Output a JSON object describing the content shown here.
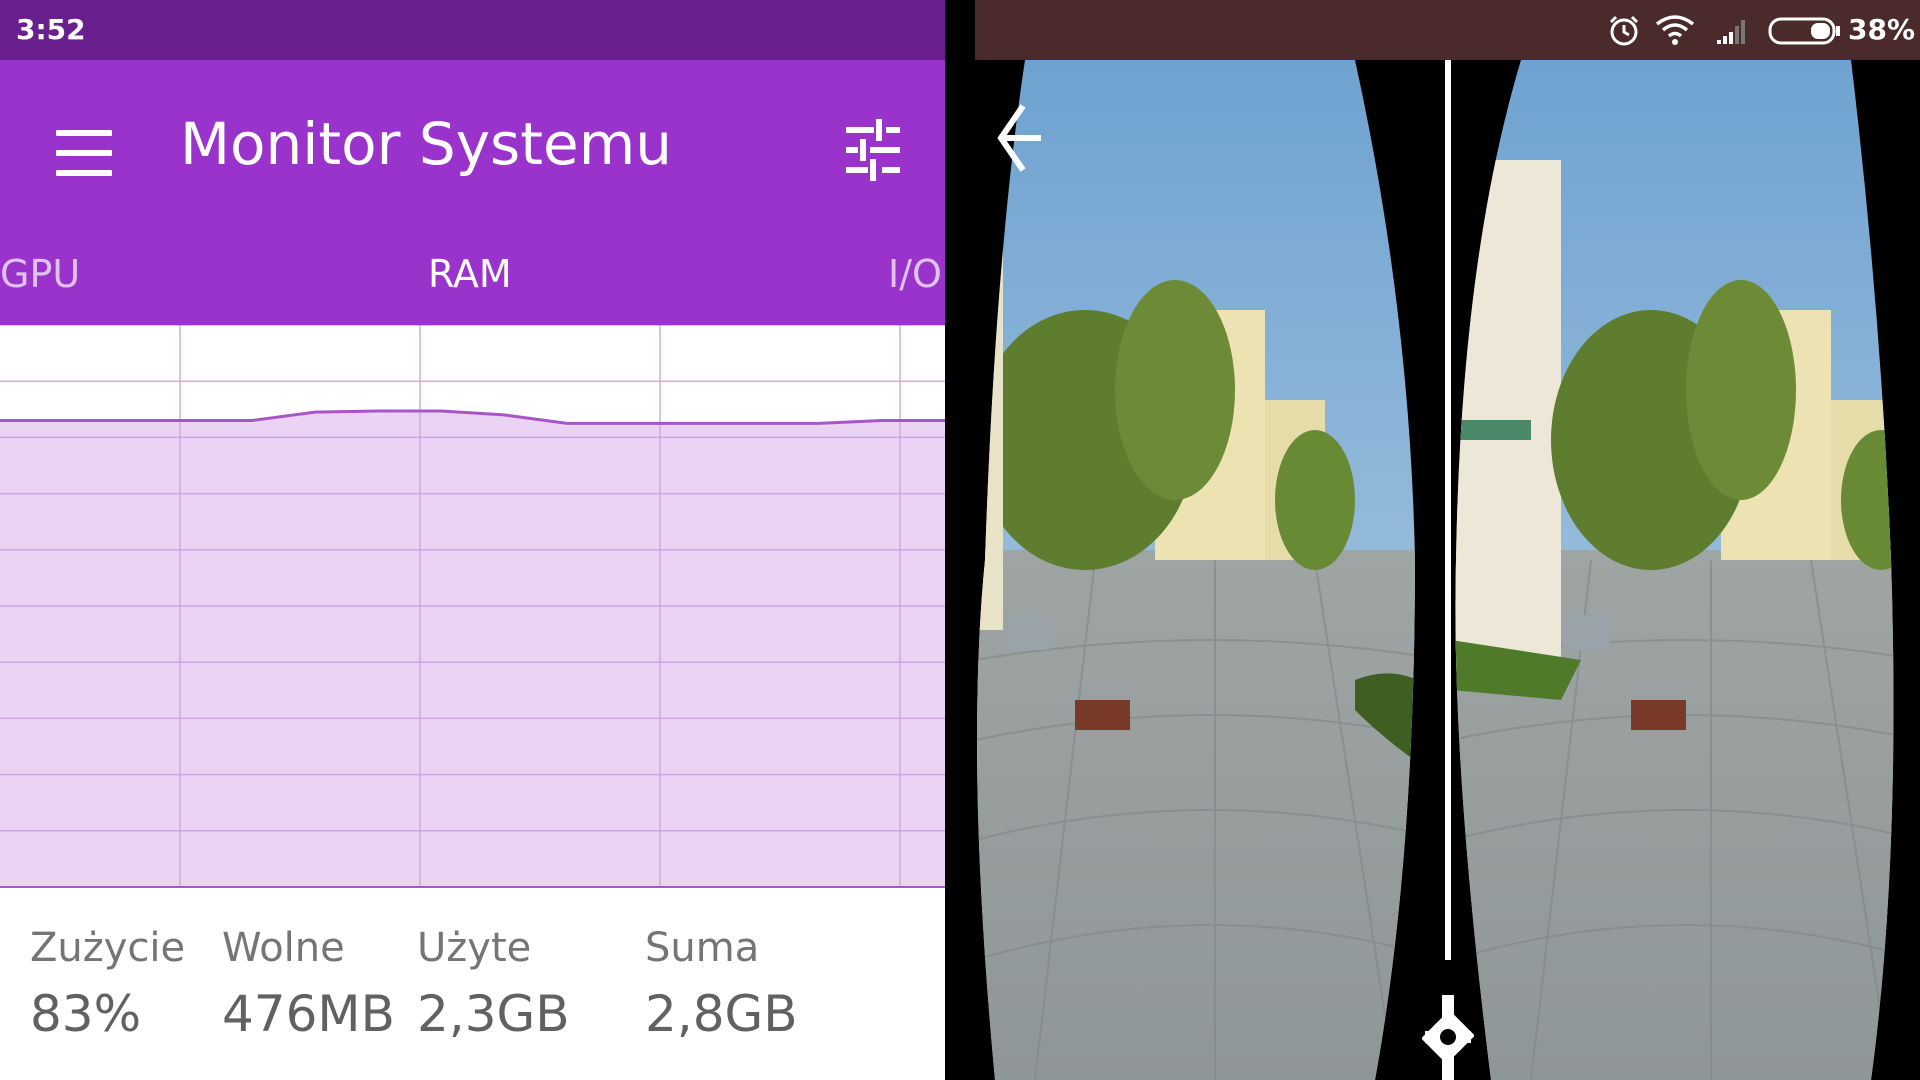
{
  "status_bar": {
    "time": "3:52",
    "battery": "38%"
  },
  "app": {
    "title": "Monitor Systemu",
    "tabs": [
      {
        "label": "GPU",
        "active": false
      },
      {
        "label": "RAM",
        "active": true
      },
      {
        "label": "I/O",
        "active": false
      }
    ],
    "icons": {
      "menu": "hamburger-menu-icon",
      "settings": "tune-sliders-icon"
    },
    "colors": {
      "app_bar": "#9933cc",
      "status_bar": "#6a1f8f",
      "chart_line": "#a855c8",
      "chart_fill": "#ebd3f3"
    }
  },
  "chart_data": {
    "type": "area",
    "usage_percent": [
      83,
      83,
      83,
      83,
      83,
      84.5,
      84.7,
      84.7,
      84,
      82.5,
      82.5,
      82.5,
      82.5,
      82.5,
      83,
      83
    ],
    "ylim": [
      0,
      100
    ],
    "grid": true
  },
  "stats": [
    {
      "label": "Zużycie",
      "value": "83%"
    },
    {
      "label": "Wolne",
      "value": "476MB"
    },
    {
      "label": "Użyte",
      "value": "2,3GB"
    },
    {
      "label": "Suma",
      "value": "2,8GB"
    }
  ],
  "vr": {
    "icons": {
      "back": "back-arrow-icon",
      "settings": "gear-icon"
    },
    "colors": {
      "status_bar": "#4a2a2a"
    }
  }
}
